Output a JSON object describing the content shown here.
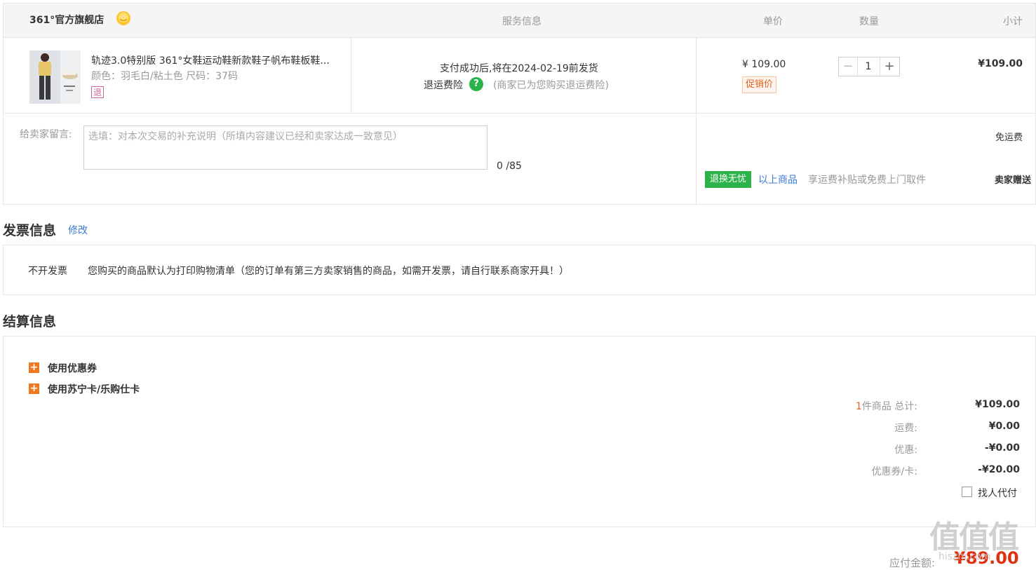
{
  "store": {
    "name": "361°官方旗舰店"
  },
  "columns": {
    "service": "服务信息",
    "unit_price": "单价",
    "quantity": "数量",
    "subtotal": "小计"
  },
  "product": {
    "title": "轨迹3.0特别版 361°女鞋运动鞋新款鞋子帆布鞋板鞋...",
    "attributes": "颜色：羽毛白/粘土色   尺码：37码",
    "return_mark": "退",
    "delivery": "支付成功后,将在2024-02-19前发货",
    "insurance_label": "退运费险",
    "insurance_icon": "?",
    "insurance_note": "(商家已为您购买退运费险)",
    "unit_price": "¥ 109.00",
    "promo_tag": "促销价",
    "quantity": "1",
    "subtotal": "¥109.00"
  },
  "message": {
    "label": "给卖家留言:",
    "placeholder": "选填：对本次交易的补充说明（所填内容建议已经和卖家达成一致意见）",
    "count": "0 /85",
    "free_shipping": "免运费",
    "worry_tag": "退换无忧",
    "worry_link": "以上商品",
    "worry_note": "享运费补贴或免费上门取件",
    "seller_gift": "卖家赠送"
  },
  "invoice": {
    "title": "发票信息",
    "edit_label": "修改",
    "type": "不开发票",
    "note": "您购买的商品默认为打印购物清单（您的订单有第三方卖家销售的商品，如需开发票，请自行联系商家开具！）"
  },
  "settlement": {
    "title": "结算信息",
    "option_coupon": "使用优惠券",
    "option_card": "使用苏宁卡/乐购仕卡",
    "items_count": "1",
    "items_label": "件商品 总计:",
    "total": "¥109.00",
    "shipping_label": "运费:",
    "shipping": "¥0.00",
    "discount_label": "优惠:",
    "discount": "-¥0.00",
    "coupon_label": "优惠券/卡:",
    "coupon": "-¥20.00",
    "agent_pay_label": "找人代付"
  },
  "footer": {
    "pay_label": "应付金额:",
    "pay_amount": "¥89.00"
  },
  "watermark": {
    "text": "值值值",
    "url": "hiszhi.com"
  },
  "colors": {
    "accent_orange": "#f07820",
    "green": "#2bb34a",
    "link_blue": "#3a7bd5"
  }
}
